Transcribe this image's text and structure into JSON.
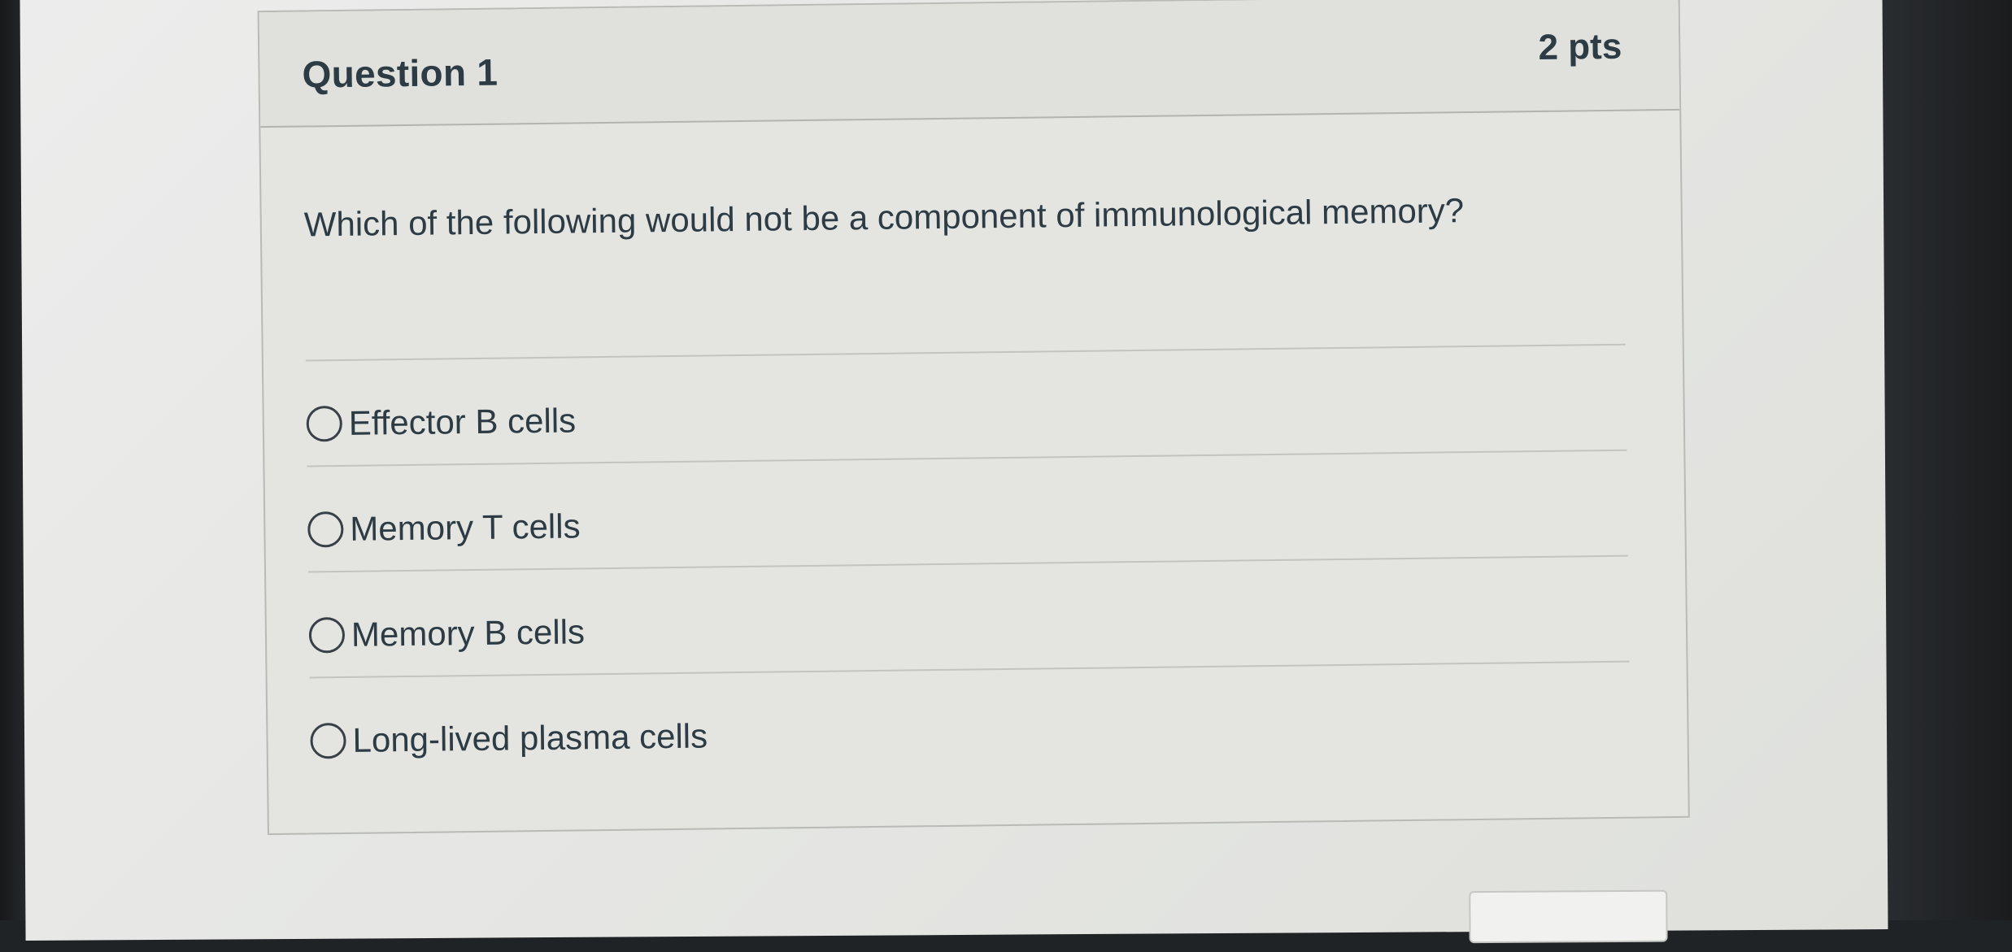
{
  "question": {
    "title": "Question 1",
    "points": "2 pts",
    "text": "Which of the following would not be a component of immunological memory?",
    "answers": [
      {
        "label": "Effector B cells"
      },
      {
        "label": "Memory T cells"
      },
      {
        "label": "Memory B cells"
      },
      {
        "label": "Long-lived plasma cells"
      }
    ]
  }
}
